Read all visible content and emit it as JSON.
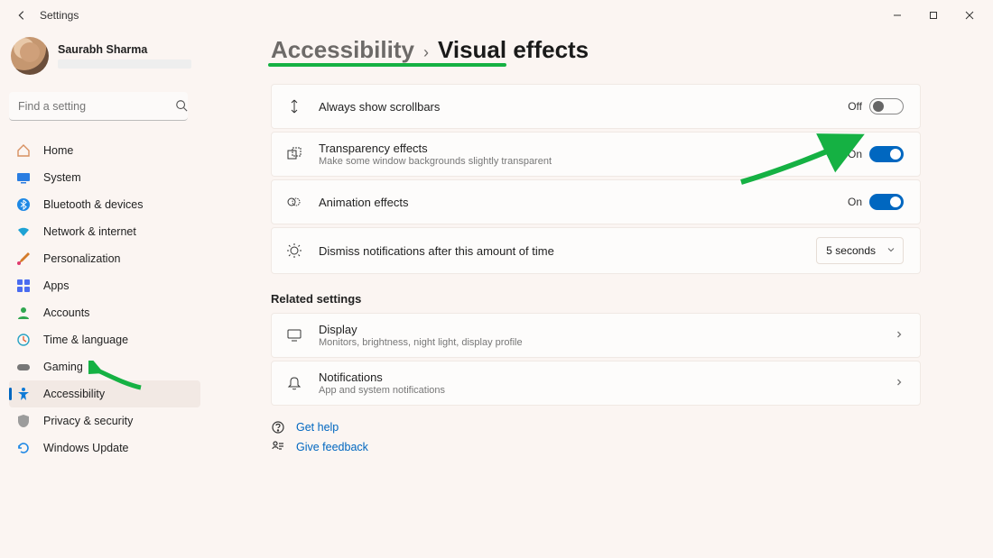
{
  "titlebar": {
    "title": "Settings"
  },
  "user": {
    "name": "Saurabh Sharma"
  },
  "search": {
    "placeholder": "Find a setting"
  },
  "nav": {
    "items": [
      {
        "label": "Home"
      },
      {
        "label": "System"
      },
      {
        "label": "Bluetooth & devices"
      },
      {
        "label": "Network & internet"
      },
      {
        "label": "Personalization"
      },
      {
        "label": "Apps"
      },
      {
        "label": "Accounts"
      },
      {
        "label": "Time & language"
      },
      {
        "label": "Gaming"
      },
      {
        "label": "Accessibility"
      },
      {
        "label": "Privacy & security"
      },
      {
        "label": "Windows Update"
      }
    ]
  },
  "breadcrumb": {
    "parent": "Accessibility",
    "sep": "›",
    "title": "Visual effects"
  },
  "settings": {
    "scrollbars": {
      "title": "Always show scrollbars",
      "state": "Off",
      "on": false
    },
    "transparency": {
      "title": "Transparency effects",
      "sub": "Make some window backgrounds slightly transparent",
      "state": "On",
      "on": true
    },
    "animation": {
      "title": "Animation effects",
      "state": "On",
      "on": true
    },
    "dismiss": {
      "title": "Dismiss notifications after this amount of time",
      "value": "5 seconds"
    }
  },
  "related": {
    "heading": "Related settings",
    "display": {
      "title": "Display",
      "sub": "Monitors, brightness, night light, display profile"
    },
    "notifications": {
      "title": "Notifications",
      "sub": "App and system notifications"
    }
  },
  "help": {
    "get_help": "Get help",
    "give_feedback": "Give feedback"
  },
  "colors": {
    "accent": "#0067c0",
    "annotation": "#15b143"
  }
}
